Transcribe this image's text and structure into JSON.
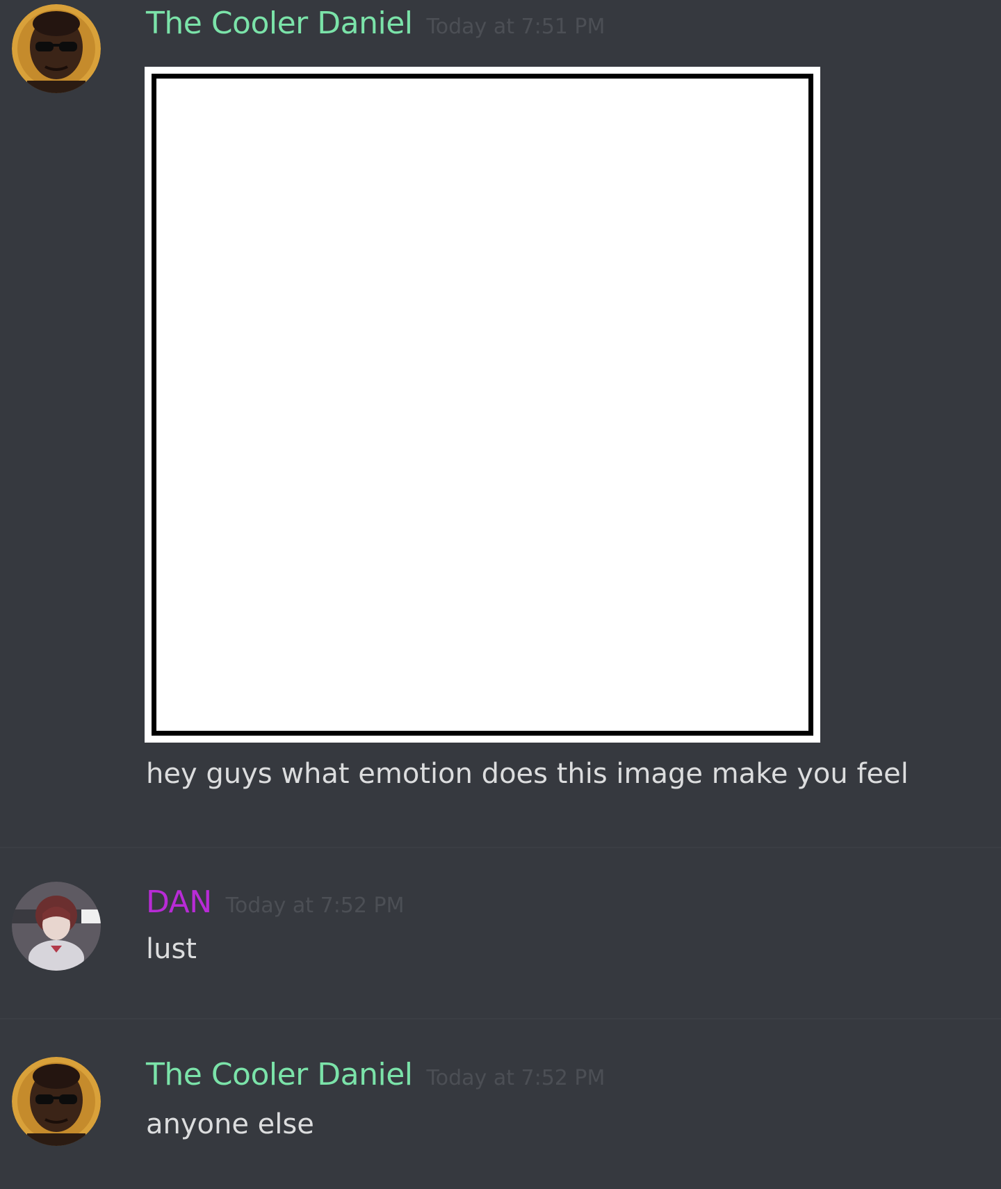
{
  "colors": {
    "background": "#36393f",
    "username_green": "#7be3a9",
    "username_purple": "#b82bd6",
    "message_text": "#dcddde",
    "timestamp": "#4c4f55",
    "attachment_bg": "#ffffff",
    "attachment_border": "#000000"
  },
  "messages": [
    {
      "username": "The Cooler Daniel",
      "timestamp": "Today at 7:51 PM",
      "avatar_icon": "user-avatar-sunglasses-icon",
      "attachment": "blank-white-square-image",
      "text": "hey guys what emotion does this image make you feel"
    },
    {
      "username": "DAN",
      "timestamp": "Today at 7:52 PM",
      "avatar_icon": "user-avatar-anime-icon",
      "text": "lust"
    },
    {
      "username": "The Cooler Daniel",
      "timestamp": "Today at 7:52 PM",
      "avatar_icon": "user-avatar-sunglasses-icon",
      "text": "anyone else"
    }
  ]
}
